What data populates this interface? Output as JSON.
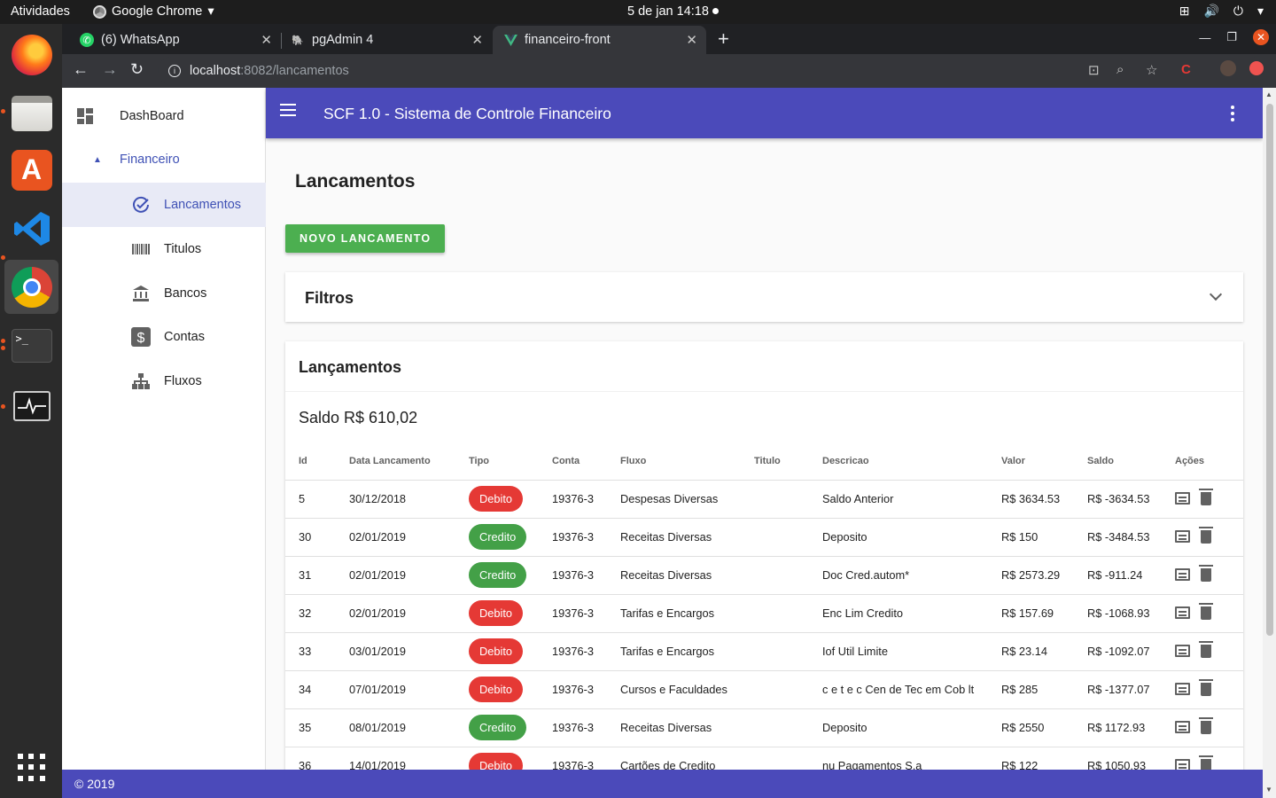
{
  "os": {
    "activities": "Atividades",
    "app_name": "Google Chrome",
    "clock": "5 de jan  14:18"
  },
  "tabs": [
    {
      "label": "(6) WhatsApp",
      "favicon": "whatsapp-icon"
    },
    {
      "label": "pgAdmin 4",
      "favicon": "pgadmin-icon"
    },
    {
      "label": "financeiro-front",
      "favicon": "vue-icon",
      "active": true
    }
  ],
  "address": {
    "host": "localhost",
    "path": ":8082/lancamentos"
  },
  "sidebar": {
    "items": [
      {
        "label": "DashBoard",
        "icon": "dashboard-icon"
      },
      {
        "label": "Financeiro",
        "icon": "expand-arrow-icon"
      },
      {
        "label": "Lancamentos",
        "icon": "check-circle-icon"
      },
      {
        "label": "Titulos",
        "icon": "barcode-icon"
      },
      {
        "label": "Bancos",
        "icon": "bank-icon"
      },
      {
        "label": "Contas",
        "icon": "dollar-icon"
      },
      {
        "label": "Fluxos",
        "icon": "sitemap-icon"
      }
    ]
  },
  "appbar": {
    "title": "SCF 1.0 - Sistema de Controle Financeiro"
  },
  "page": {
    "title": "Lancamentos",
    "new_button": "NOVO LANCAMENTO",
    "filters_title": "Filtros",
    "card_title": "Lançamentos",
    "saldo": "Saldo R$ 610,02"
  },
  "table": {
    "headers": [
      "Id",
      "Data Lancamento",
      "Tipo",
      "Conta",
      "Fluxo",
      "Titulo",
      "Descricao",
      "Valor",
      "Saldo",
      "Ações"
    ],
    "rows": [
      {
        "id": "5",
        "data": "30/12/2018",
        "tipo": "Debito",
        "conta": "19376-3",
        "fluxo": "Despesas Diversas",
        "titulo": "",
        "descricao": "Saldo Anterior",
        "valor": "R$ 3634.53",
        "saldo": "R$ -3634.53"
      },
      {
        "id": "30",
        "data": "02/01/2019",
        "tipo": "Credito",
        "conta": "19376-3",
        "fluxo": "Receitas Diversas",
        "titulo": "",
        "descricao": "Deposito",
        "valor": "R$ 150",
        "saldo": "R$ -3484.53"
      },
      {
        "id": "31",
        "data": "02/01/2019",
        "tipo": "Credito",
        "conta": "19376-3",
        "fluxo": "Receitas Diversas",
        "titulo": "",
        "descricao": "Doc Cred.autom*",
        "valor": "R$ 2573.29",
        "saldo": "R$ -911.24"
      },
      {
        "id": "32",
        "data": "02/01/2019",
        "tipo": "Debito",
        "conta": "19376-3",
        "fluxo": "Tarifas e Encargos",
        "titulo": "",
        "descricao": "Enc Lim Credito",
        "valor": "R$ 157.69",
        "saldo": "R$ -1068.93"
      },
      {
        "id": "33",
        "data": "03/01/2019",
        "tipo": "Debito",
        "conta": "19376-3",
        "fluxo": "Tarifas e Encargos",
        "titulo": "",
        "descricao": "Iof Util Limite",
        "valor": "R$ 23.14",
        "saldo": "R$ -1092.07"
      },
      {
        "id": "34",
        "data": "07/01/2019",
        "tipo": "Debito",
        "conta": "19376-3",
        "fluxo": "Cursos e Faculdades",
        "titulo": "",
        "descricao": "c e t e c Cen de Tec em Cob lt",
        "valor": "R$ 285",
        "saldo": "R$ -1377.07"
      },
      {
        "id": "35",
        "data": "08/01/2019",
        "tipo": "Credito",
        "conta": "19376-3",
        "fluxo": "Receitas Diversas",
        "titulo": "",
        "descricao": "Deposito",
        "valor": "R$ 2550",
        "saldo": "R$ 1172.93"
      },
      {
        "id": "36",
        "data": "14/01/2019",
        "tipo": "Debito",
        "conta": "19376-3",
        "fluxo": "Cartões de Credito",
        "titulo": "",
        "descricao": "nu Pagamentos S.a",
        "valor": "R$ 122",
        "saldo": "R$ 1050.93"
      }
    ]
  },
  "footer": "© 2019",
  "colors": {
    "primary": "#4b4aba",
    "debito": "#e53935",
    "credito": "#43a047",
    "new_button": "#4caf50"
  }
}
